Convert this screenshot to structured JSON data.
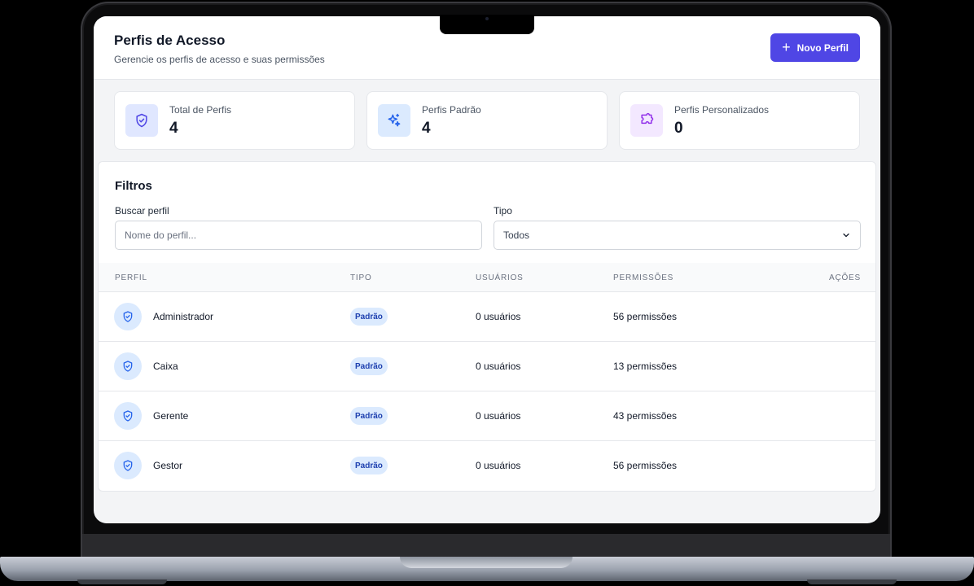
{
  "header": {
    "title": "Perfis de Acesso",
    "subtitle": "Gerencie os perfis de acesso e suas permissões",
    "new_button": "Novo Perfil"
  },
  "stats": [
    {
      "label": "Total de Perfis",
      "value": "4",
      "icon": "shield-check-icon",
      "color": "#4f46e5",
      "bg": "#e0e7ff"
    },
    {
      "label": "Perfis Padrão",
      "value": "4",
      "icon": "sparkles-icon",
      "color": "#2563eb",
      "bg": "#dbeafe"
    },
    {
      "label": "Perfis Personalizados",
      "value": "0",
      "icon": "puzzle-icon",
      "color": "#9333ea",
      "bg": "#f3e8ff"
    }
  ],
  "filters": {
    "title": "Filtros",
    "search_label": "Buscar perfil",
    "search_placeholder": "Nome do perfil...",
    "type_label": "Tipo",
    "type_value": "Todos"
  },
  "table": {
    "headers": [
      "PERFIL",
      "TIPO",
      "USUÁRIOS",
      "PERMISSÕES",
      "AÇÕES"
    ],
    "rows": [
      {
        "name": "Administrador",
        "type": "Padrão",
        "users": "0 usuários",
        "permissions": "56 permissões"
      },
      {
        "name": "Caixa",
        "type": "Padrão",
        "users": "0 usuários",
        "permissions": "13 permissões"
      },
      {
        "name": "Gerente",
        "type": "Padrão",
        "users": "0 usuários",
        "permissions": "43 permissões"
      },
      {
        "name": "Gestor",
        "type": "Padrão",
        "users": "0 usuários",
        "permissions": "56 permissões"
      }
    ]
  },
  "colors": {
    "accent": "#4f46e5",
    "badge_bg": "#dbeafe",
    "badge_text": "#1e40af"
  }
}
